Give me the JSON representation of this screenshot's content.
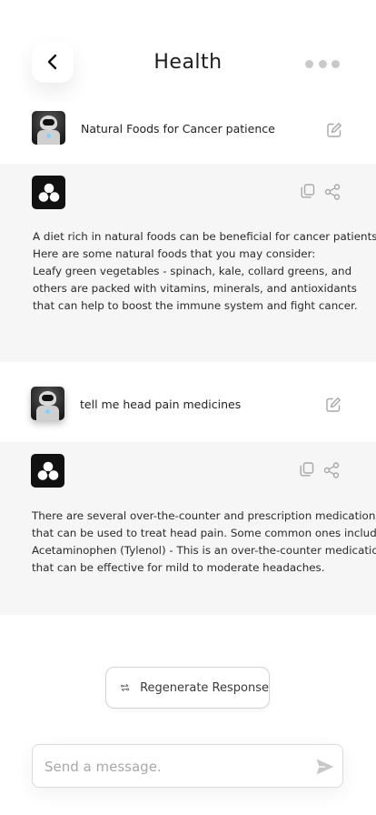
{
  "header": {
    "title": "Health",
    "back_icon": "chevron-left-icon",
    "more_icon": "more-dots-icon"
  },
  "conversation": [
    {
      "prompt": "Natural Foods for Cancer patience",
      "response_lines": [
        "A diet rich in natural foods can be beneficial for cancer patients.",
        "Here are some natural foods that you may consider:",
        "Leafy green vegetables - spinach, kale, collard greens, and",
        "others are packed with vitamins, minerals, and antioxidants",
        "that can help to boost the immune system and fight cancer."
      ]
    },
    {
      "prompt": "tell me head pain medicines",
      "response_lines": [
        "There are several over-the-counter and prescription medications",
        "that can be used to treat head pain. Some common ones include:",
        "Acetaminophen (Tylenol) - This is an over-the-counter medication",
        "that can be effective for mild to moderate headaches."
      ]
    }
  ],
  "regenerate": {
    "label": "Regenerate Response"
  },
  "composer": {
    "placeholder": "Send a message."
  },
  "colors": {
    "bot_block_bg": "#f6f6f6",
    "logo_bg": "#111111",
    "icon_gray": "#a8a8a8"
  }
}
